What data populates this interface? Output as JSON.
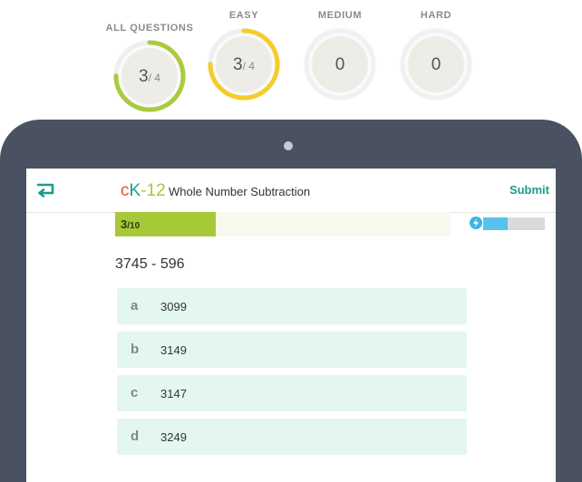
{
  "score_rings": [
    {
      "label": "ALL QUESTIONS",
      "value": "3",
      "denominator": "/ 4",
      "progress": 0.75,
      "color": "#a9cb3c"
    },
    {
      "label": "EASY",
      "value": "3",
      "denominator": "/ 4",
      "progress": 0.75,
      "color": "#f5cd2b"
    },
    {
      "label": "MEDIUM",
      "value": "0",
      "denominator": "",
      "progress": 0,
      "color": "#d8d8d8"
    },
    {
      "label": "HARD",
      "value": "0",
      "denominator": "",
      "progress": 0,
      "color": "#d8d8d8"
    }
  ],
  "app": {
    "logo": {
      "c": "c",
      "k": "K",
      "dash": "-",
      "num": "12"
    },
    "title": "Whole Number Subtraction",
    "submit_label": "Submit",
    "back_icon": "back-arrow-icon"
  },
  "progress": {
    "current": "3",
    "total": "/10",
    "fraction": 0.3
  },
  "energy": {
    "icon": "lightning-bolt-icon",
    "fraction": 0.4,
    "color": "#58c2ec"
  },
  "question": {
    "text": "3745 - 596"
  },
  "options": [
    {
      "letter": "a",
      "answer": "3099"
    },
    {
      "letter": "b",
      "answer": "3149"
    },
    {
      "letter": "c",
      "answer": "3147"
    },
    {
      "letter": "d",
      "answer": "3249"
    }
  ],
  "colors": {
    "accent": "#1d9a8c",
    "progress_fill": "#a7c938",
    "option_bg": "#e3f7ef",
    "tablet_frame": "#4a5160"
  }
}
